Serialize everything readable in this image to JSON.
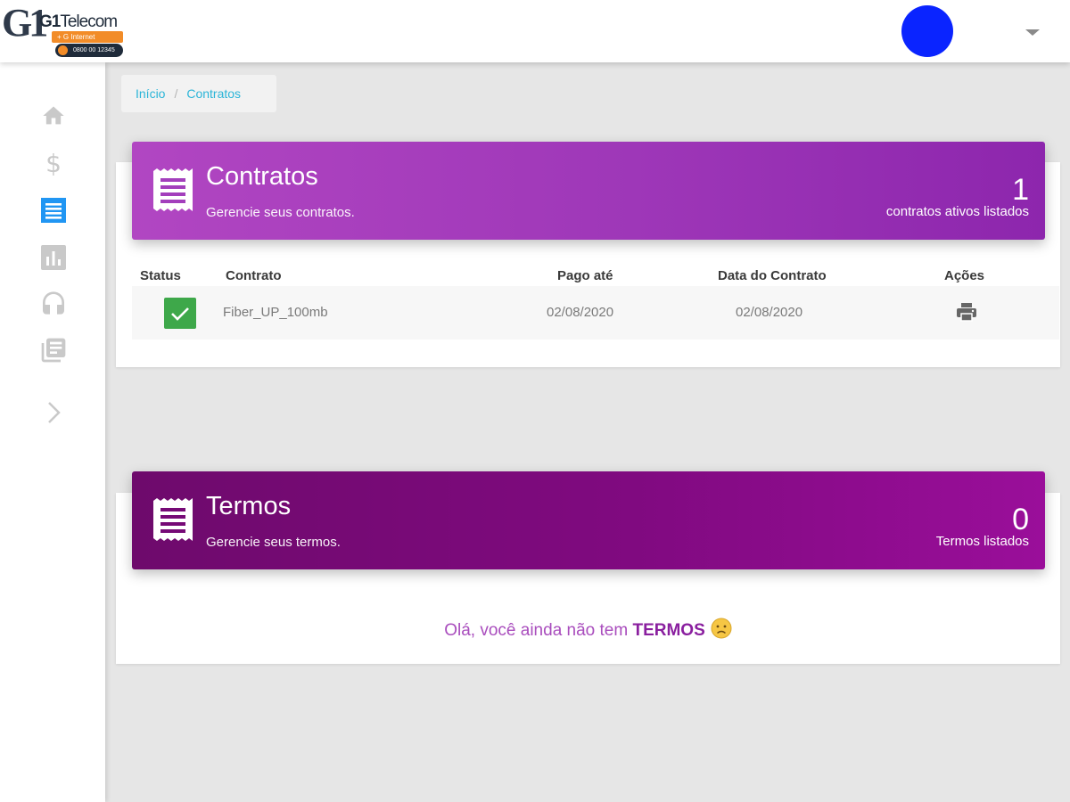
{
  "brand": {
    "mark": "G1",
    "name_bold": "G1",
    "name_rest": "Telecom",
    "tagline": "+ G Internet",
    "phone": "0800 00 12345"
  },
  "breadcrumb": {
    "home": "Início",
    "separator": "/",
    "current": "Contratos"
  },
  "sidebar": {
    "items": [
      {
        "icon": "home-icon"
      },
      {
        "icon": "dollar-icon"
      },
      {
        "icon": "contract-list-icon",
        "active": true
      },
      {
        "icon": "bar-chart-icon"
      },
      {
        "icon": "headset-icon"
      },
      {
        "icon": "library-icon"
      },
      {
        "icon": "chevron-right-icon"
      }
    ]
  },
  "contracts": {
    "title": "Contratos",
    "subtitle": "Gerencie seus contratos.",
    "count": "1",
    "count_label": "contratos ativos listados",
    "columns": {
      "status": "Status",
      "contract": "Contrato",
      "paid_until": "Pago até",
      "contract_date": "Data do Contrato",
      "actions": "Ações"
    },
    "rows": [
      {
        "contract": "Fiber_UP_100mb",
        "paid_until": "02/08/2020",
        "contract_date": "02/08/2020",
        "status": "ativo"
      }
    ]
  },
  "terms": {
    "title": "Termos",
    "subtitle": "Gerencie seus termos.",
    "count": "0",
    "count_label": "Termos listados",
    "empty_prefix": "Olá, você ainda não tem",
    "empty_bold": "TERMOS"
  },
  "colors": {
    "accent": "#9c37b6",
    "terms_header": "#7a0a7a",
    "link": "#2bb5d8",
    "status_ok": "#3ea84a",
    "avatar": "#0a24ff"
  }
}
